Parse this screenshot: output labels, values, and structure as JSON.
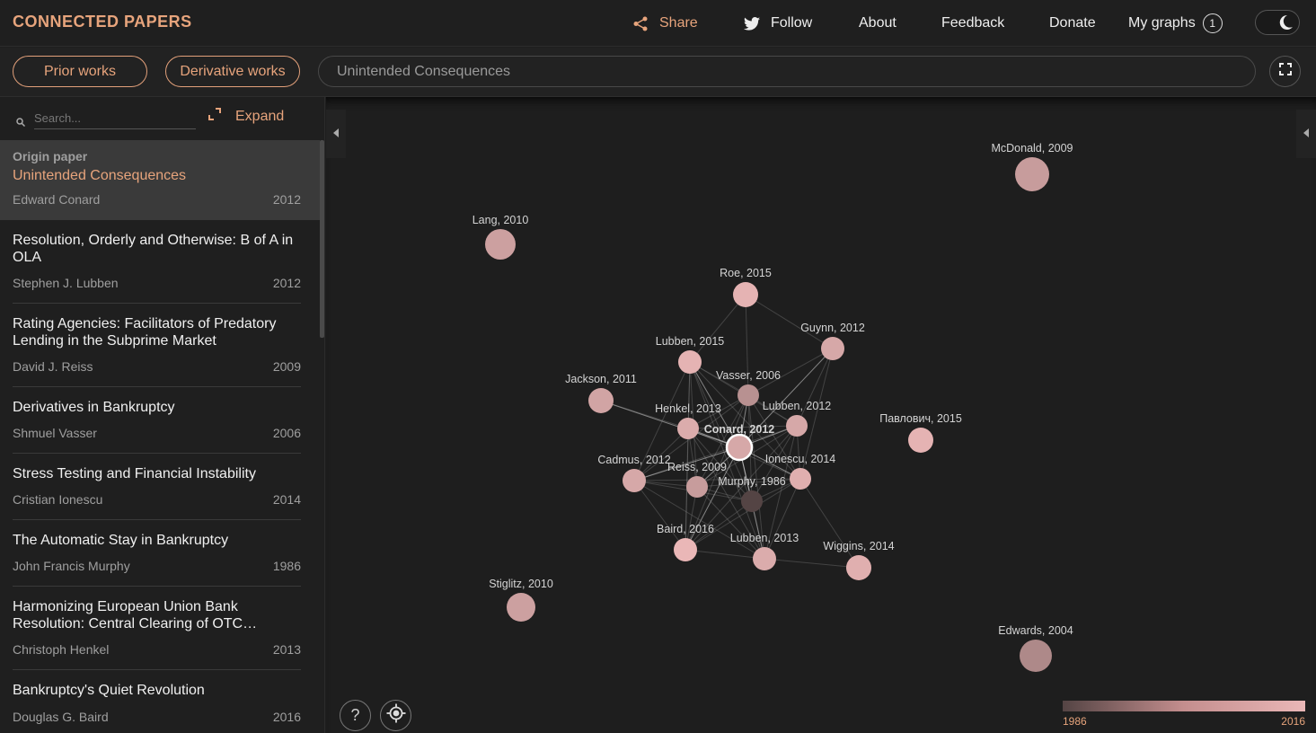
{
  "header": {
    "logo": "CONNECTED PAPERS",
    "share": "Share",
    "follow": "Follow",
    "about": "About",
    "feedback": "Feedback",
    "donate": "Donate",
    "my_graphs": "My graphs",
    "my_graphs_count": "1"
  },
  "toolbar": {
    "prior_works": "Prior works",
    "derivative_works": "Derivative works",
    "graph_title": "Unintended Consequences"
  },
  "sidebar": {
    "search_placeholder": "Search...",
    "expand": "Expand",
    "origin": {
      "label": "Origin paper",
      "title": "Unintended Consequences",
      "author": "Edward Conard",
      "year": "2012"
    },
    "papers": [
      {
        "title": "Resolution, Orderly and Otherwise: B of A in OLA",
        "author": "Stephen J. Lubben",
        "year": "2012"
      },
      {
        "title": "Rating Agencies: Facilitators of Predatory Lending in the Subprime Market",
        "author": "David J. Reiss",
        "year": "2009"
      },
      {
        "title": "Derivatives in Bankruptcy",
        "author": "Shmuel Vasser",
        "year": "2006"
      },
      {
        "title": "Stress Testing and Financial Instability",
        "author": "Cristian Ionescu",
        "year": "2014"
      },
      {
        "title": "The Automatic Stay in Bankruptcy",
        "author": "John Francis Murphy",
        "year": "1986"
      },
      {
        "title": "Harmonizing European Union Bank Resolution: Central Clearing of OTC Derivatives",
        "author": "Christoph Henkel",
        "year": "2013"
      },
      {
        "title": "Bankruptcy's Quiet Revolution",
        "author": "Douglas G. Baird",
        "year": "2016"
      }
    ]
  },
  "graph": {
    "nodes": [
      {
        "label": "McDonald, 2009",
        "year": 2009
      },
      {
        "label": "Lang, 2010",
        "year": 2010
      },
      {
        "label": "Roe, 2015",
        "year": 2015
      },
      {
        "label": "Guynn, 2012",
        "year": 2012
      },
      {
        "label": "Lubben, 2015",
        "year": 2015
      },
      {
        "label": "Vasser, 2006",
        "year": 2006
      },
      {
        "label": "Jackson, 2011",
        "year": 2011
      },
      {
        "label": "Henkel, 2013",
        "year": 2013
      },
      {
        "label": "Lubben, 2012",
        "year": 2012
      },
      {
        "label": "Conard, 2012",
        "year": 2012,
        "origin": true
      },
      {
        "label": "Павлович, 2015",
        "year": 2015
      },
      {
        "label": "Cadmus, 2012",
        "year": 2012
      },
      {
        "label": "Reiss, 2009",
        "year": 2009
      },
      {
        "label": "Ionescu, 2014",
        "year": 2014
      },
      {
        "label": "Murphy, 1986",
        "year": 1986
      },
      {
        "label": "Baird, 2016",
        "year": 2016
      },
      {
        "label": "Lubben, 2013",
        "year": 2013
      },
      {
        "label": "Wiggins, 2014",
        "year": 2014
      },
      {
        "label": "Stiglitz, 2010",
        "year": 2010
      },
      {
        "label": "Edwards, 2004",
        "year": 2004
      }
    ],
    "legend": {
      "min_year": "1986",
      "max_year": "2016"
    },
    "help_icon": "?"
  },
  "colors": {
    "accent": "#e7a47c",
    "node_old": "#544444",
    "node_new": "#eab7b7"
  }
}
